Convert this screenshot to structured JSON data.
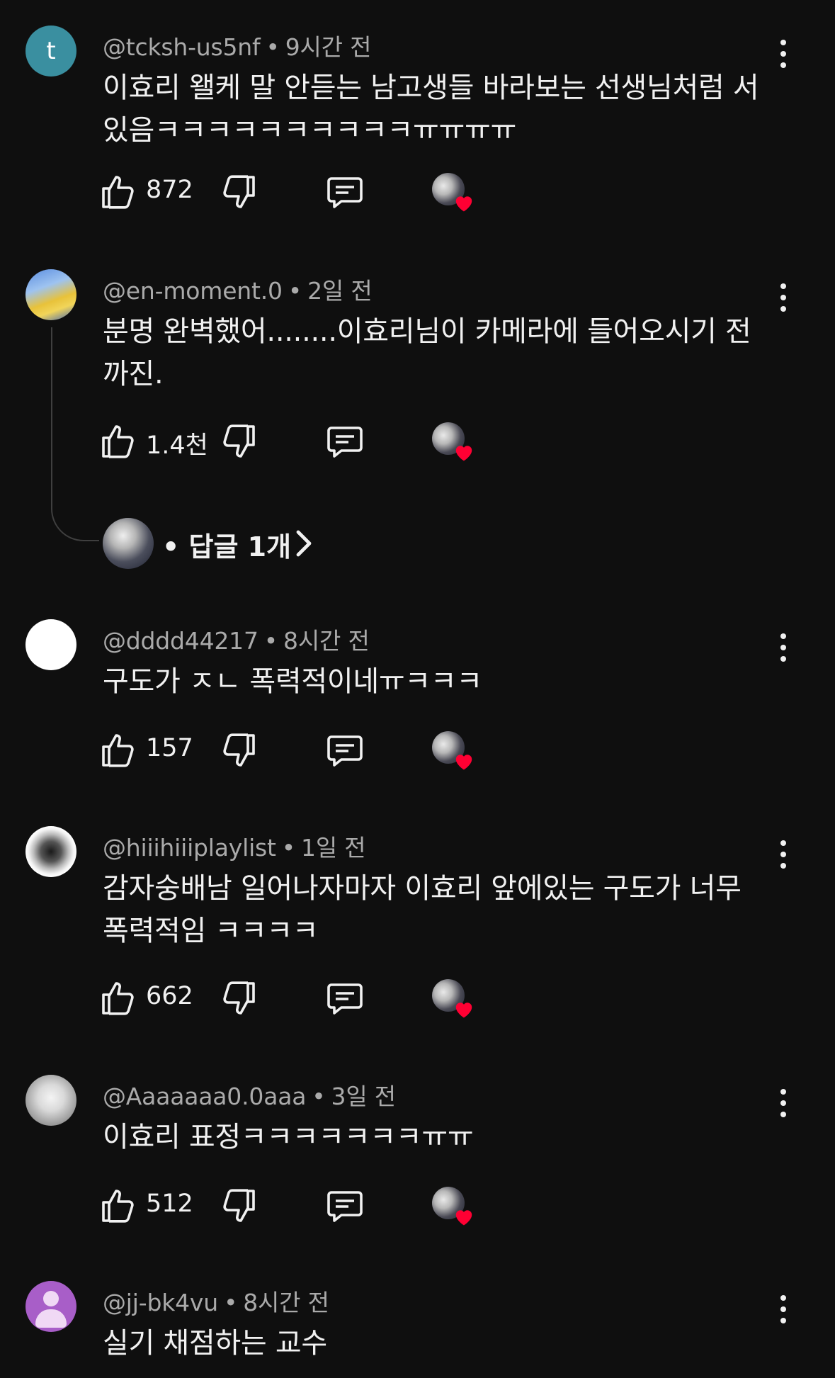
{
  "comments": [
    {
      "author": "@tcksh-us5nf",
      "time": "9시간 전",
      "avatar_letter": "t",
      "text": "이효리 왤케 말 안듣는 남고생들 바라보는 선생님처럼 서 있음ㅋㅋㅋㅋㅋㅋㅋㅋㅋㅋㅠㅠㅠㅠ",
      "likes": "872"
    },
    {
      "author": "@en-moment.0",
      "time": "2일 전",
      "text": "분명 완벽했어........이효리님이 카메라에 들어오시기 전까진.",
      "likes": "1.4천",
      "replies_label": "답글 1개"
    },
    {
      "author": "@dddd44217",
      "time": "8시간 전",
      "text": "구도가 ㅈㄴ 폭력적이네ㅠㅋㅋㅋ",
      "likes": "157"
    },
    {
      "author": "@hiiihiiiplaylist",
      "time": "1일 전",
      "text": "감자숭배남 일어나자마자 이효리 앞에있는 구도가 너무 폭력적임 ㅋㅋㅋㅋ",
      "likes": "662"
    },
    {
      "author": "@Aaaaaaa0.0aaa",
      "time": "3일 전",
      "text": "이효리 표정ㅋㅋㅋㅋㅋㅋㅋㅠㅠ",
      "likes": "512"
    },
    {
      "author": "@jj-bk4vu",
      "time": "8시간 전",
      "text": "실기 채점하는 교수"
    }
  ],
  "separator": "•",
  "colors": {
    "background": "#0f0f0f",
    "primary_text": "#f1f1f1",
    "secondary_text": "#aaaaaa",
    "heart": "#ff0033"
  },
  "icons": [
    "thumbs-up-icon",
    "thumbs-down-icon",
    "reply-comment-icon",
    "creator-heart-icon",
    "more-vert-icon",
    "chevron-right-icon"
  ]
}
